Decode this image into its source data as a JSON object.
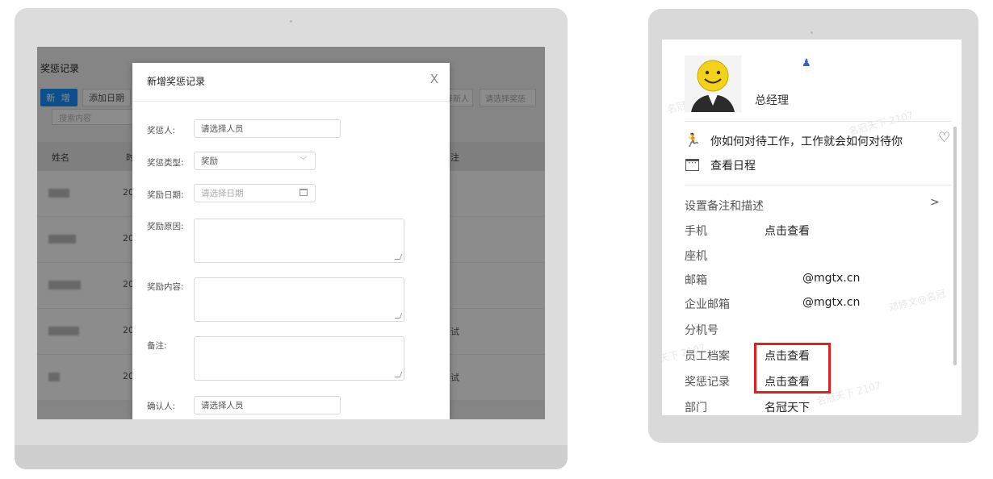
{
  "left_app": {
    "page_title": "奖惩记录",
    "new_button": "新 增",
    "add_date_button": "添加日期",
    "search_placeholder": "搜索内容",
    "filter_person": "选择新人",
    "filter_type": "请选择奖惩",
    "columns": {
      "name": "姓名",
      "time": "时",
      "note": "注"
    },
    "rows": [
      {
        "year": "20",
        "note": ""
      },
      {
        "year": "20",
        "note": ""
      },
      {
        "year": "20",
        "note": ""
      },
      {
        "year": "20",
        "note": "试"
      },
      {
        "year": "20",
        "note": "试"
      }
    ]
  },
  "modal": {
    "title": "新增奖惩记录",
    "close": "X",
    "fields": {
      "person_label": "奖惩人:",
      "person_placeholder": "请选择人员",
      "type_label": "奖惩类型:",
      "type_value": "奖励",
      "date_label": "奖励日期:",
      "date_placeholder": "请选择日期",
      "reason_label": "奖励原因:",
      "content_label": "奖励内容:",
      "remark_label": "备注:",
      "confirm_label": "确认人:",
      "confirm_placeholder": "请选择人员"
    }
  },
  "profile": {
    "job_title": "总经理",
    "motto": "你如何对待工作，工作就会如何对待你",
    "schedule": "查看日程",
    "settings": "设置备注和描述",
    "fields": [
      {
        "label": "手机",
        "value": "点击查看"
      },
      {
        "label": "座机",
        "value": ""
      },
      {
        "label": "邮箱",
        "value": "@mgtx.cn"
      },
      {
        "label": "企业邮箱",
        "value": "@mgtx.cn"
      },
      {
        "label": "分机号",
        "value": ""
      },
      {
        "label": "员工档案",
        "value": "点击查看"
      },
      {
        "label": "奖惩记录",
        "value": "点击查看"
      },
      {
        "label": "部门",
        "value": "名冠天下"
      }
    ],
    "watermarks": [
      "名冠天下 2107",
      "邓婷文@名冠",
      "天下 2107",
      "名冠天下 2107",
      "名冠天下 2107"
    ]
  },
  "colors": {
    "primary": "#1890ff",
    "highlight": "#e02020",
    "person_icon": "#3a63c8"
  },
  "icons": {
    "motto": "runner-icon",
    "heart": "heart-icon",
    "schedule": "calendar-icon",
    "arrow": "chevron-right-icon",
    "user": "user-icon"
  }
}
